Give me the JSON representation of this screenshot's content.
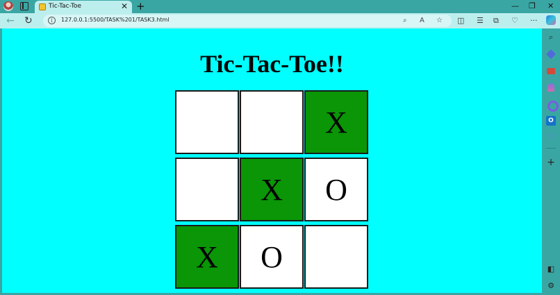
{
  "browser": {
    "tab_title": "Tic-Tac-Toe",
    "url": "127.0.0.1:5500/TASK%201/TASK3.html",
    "new_tab_symbol": "+",
    "tab_close_symbol": "✕",
    "window_minimize": "—",
    "window_maximize": "❐",
    "window_close": "✕",
    "icons": {
      "back": "back-arrow-icon",
      "refresh": "refresh-icon",
      "info": "info-icon",
      "zoom": "zoom-icon",
      "read_aloud": "read-aloud-icon",
      "favorite": "star-icon",
      "split": "split-screen-icon",
      "favorites": "favorites-icon",
      "collections": "collections-icon",
      "performance": "heart-pulse-icon",
      "more": "more-icon",
      "copilot": "copilot-icon"
    },
    "glyphs": {
      "back": "←",
      "refresh": "↻",
      "info": "i",
      "zoom": "⌕",
      "read_aloud": "A",
      "favorite": "☆",
      "split": "◫",
      "favorites": "☰",
      "collections": "⧉",
      "performance": "♡",
      "more": "···",
      "sidebar_search": "⌕",
      "sidebar_drop": "▽",
      "sidebar_plus": "+",
      "sidebar_panel": "◧",
      "sidebar_settings": "⚙"
    }
  },
  "page": {
    "title": "Tic-Tac-Toe!!",
    "background_color": "#00ffff",
    "win_color": "#0a9606",
    "board": [
      {
        "mark": "",
        "win": false
      },
      {
        "mark": "",
        "win": false
      },
      {
        "mark": "X",
        "win": true
      },
      {
        "mark": "",
        "win": false
      },
      {
        "mark": "X",
        "win": true
      },
      {
        "mark": "O",
        "win": false
      },
      {
        "mark": "X",
        "win": true
      },
      {
        "mark": "O",
        "win": false
      },
      {
        "mark": "",
        "win": false
      }
    ]
  }
}
